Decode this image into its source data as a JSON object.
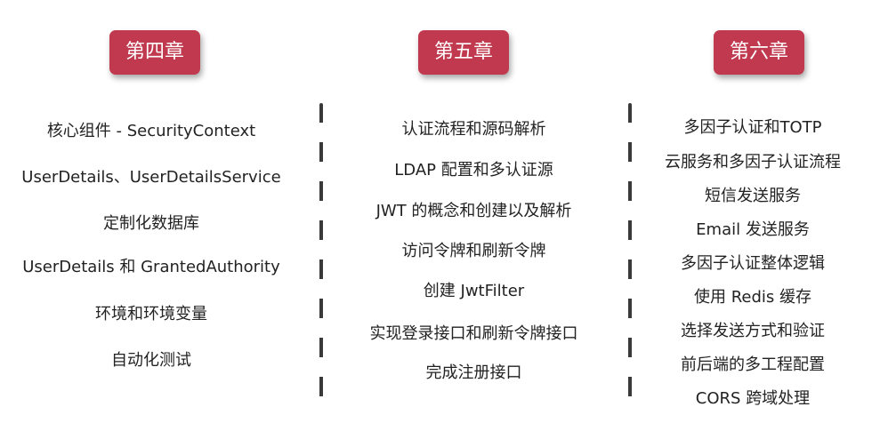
{
  "chapters": [
    {
      "title": "第四章",
      "items": [
        "核心组件 - SecurityContext",
        "UserDetails、UserDetailsService",
        "定制化数据库",
        "UserDetails 和 GrantedAuthority",
        "环境和环境变量",
        "自动化测试"
      ]
    },
    {
      "title": "第五章",
      "items": [
        "认证流程和源码解析",
        "LDAP 配置和多认证源",
        "JWT 的概念和创建以及解析",
        "访问令牌和刷新令牌",
        "创建 JwtFilter",
        "实现登录接口和刷新令牌接口",
        "完成注册接口"
      ]
    },
    {
      "title": "第六章",
      "items": [
        "多因子认证和TOTP",
        "云服务和多因子认证流程",
        "短信发送服务",
        "Email 发送服务",
        "多因子认证整体逻辑",
        "使用 Redis 缓存",
        "选择发送方式和验证",
        "前后端的多工程配置",
        "CORS 跨域处理"
      ]
    }
  ],
  "colors": {
    "chapter_bg": "#c0394e",
    "chapter_text": "#ffffff",
    "divider": "#3a3a3a"
  }
}
